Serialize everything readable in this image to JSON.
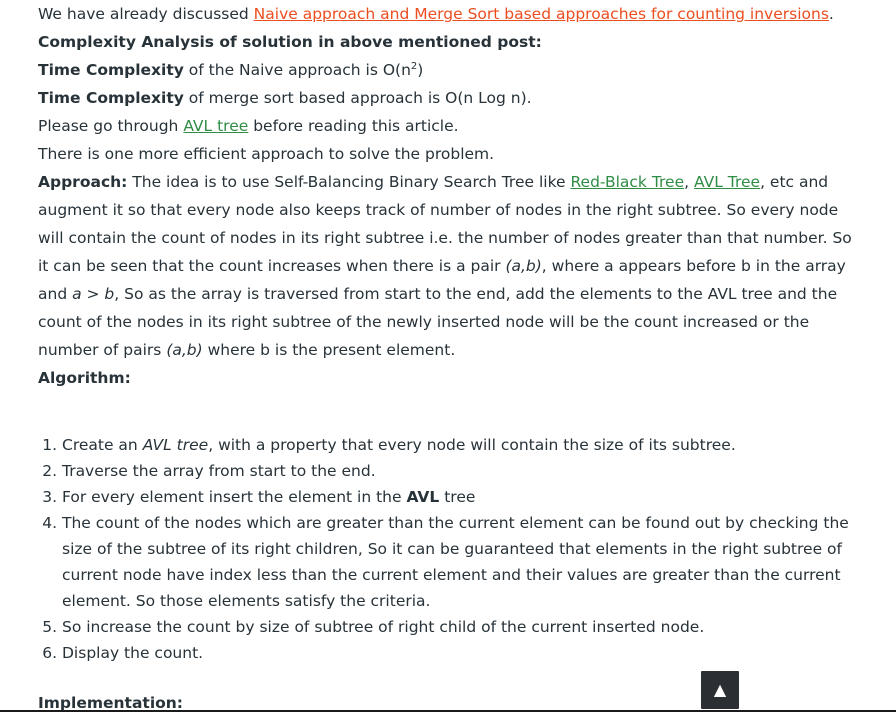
{
  "intro": {
    "prefix": "We have already discussed ",
    "link": "Naive approach and Merge Sort based approaches for counting inversions",
    "suffix": "."
  },
  "complexity_heading": "Complexity Analysis of solution in above mentioned post:",
  "time1": {
    "label": "Time Complexity",
    "text": " of the Naive approach is ",
    "formula": "O(n",
    "exp": "2",
    "close": ")"
  },
  "time2": {
    "label": "Time Complexity",
    "text": " of merge sort based approach is ",
    "formula": "O(n Log n)",
    "suffix": "."
  },
  "prereq": {
    "prefix": "Please go through ",
    "link": "AVL tree",
    "suffix": " before reading this article."
  },
  "efficient": "There is one more efficient approach to solve the problem.",
  "approach": {
    "label": "Approach:",
    "t1": " The idea is to use Self-Balancing Binary Search Tree like ",
    "link1": "Red-Black Tree",
    "comma": ", ",
    "link2": "AVL Tree",
    "t2": ", etc and augment it so that every node also keeps track of number of nodes in the right subtree. So every node will contain the count of nodes in its right subtree i.e. the number of nodes greater than that number. So it can be seen that the count increases when there is a pair ",
    "pair1": "(a,b)",
    "t3": ", where a appears before b in the array and ",
    "cond": "a > b",
    "t4": ", So as the array is traversed from start to the end, add the elements to the AVL tree and the count of the nodes in its right subtree of the newly inserted node will be the count increased or the number of pairs ",
    "pair2": "(a,b)",
    "t5": " where b is the present element."
  },
  "algorithm_heading": "Algorithm:",
  "steps": {
    "s1_pre": "Create an ",
    "s1_em": "AVL tree",
    "s1_post": ", with a property that every node will contain the size of its subtree.",
    "s2": "Traverse the array from start to the end.",
    "s3_pre": "For every element insert the element in the ",
    "s3_bold": "AVL",
    "s3_post": " tree",
    "s4": "The count of the nodes which are greater than the current element can be found out by checking the size of the subtree of its right children, So it can be guaranteed that elements in the right subtree of current node have index less than the current element and their values are greater than the current element. So those elements satisfy the criteria.",
    "s5": "So increase the count by size of subtree of right child of the current inserted node.",
    "s6": "Display the count."
  },
  "implementation_heading": "Implementation:",
  "scroll_top_icon": "▲"
}
